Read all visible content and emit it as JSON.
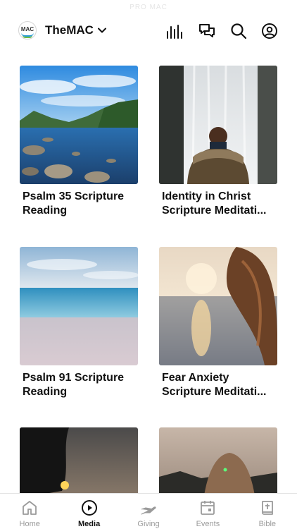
{
  "status": {
    "carrier_text": "PRO MAC"
  },
  "header": {
    "logo_text": "MAC",
    "org_name": "TheMAC",
    "icons": [
      "chevron-down-icon",
      "audio-bars-icon",
      "chat-bubbles-icon",
      "search-icon",
      "profile-icon"
    ]
  },
  "cards": [
    {
      "title": "Psalm 35 Scripture\nReading",
      "image": "lake-landscape"
    },
    {
      "title": "Identity in Christ\nScripture Meditati...",
      "image": "waterfall-person"
    },
    {
      "title": "Psalm 91 Scripture\nReading",
      "image": "ocean-horizon"
    },
    {
      "title": "Fear Anxiety\nScripture Meditati...",
      "image": "sunset-hair"
    },
    {
      "title": "",
      "image": "tree-sunset"
    },
    {
      "title": "",
      "image": "woman-back-dusk"
    }
  ],
  "tabs": [
    {
      "label": "Home",
      "icon": "home-icon",
      "active": false
    },
    {
      "label": "Media",
      "icon": "play-circle-icon",
      "active": true
    },
    {
      "label": "Giving",
      "icon": "giving-hand-icon",
      "active": false
    },
    {
      "label": "Events",
      "icon": "calendar-icon",
      "active": false
    },
    {
      "label": "Bible",
      "icon": "bible-icon",
      "active": false
    }
  ],
  "colors": {
    "accent": "#111111",
    "inactive": "#9a9a9a",
    "divider": "#e3e3e3"
  }
}
